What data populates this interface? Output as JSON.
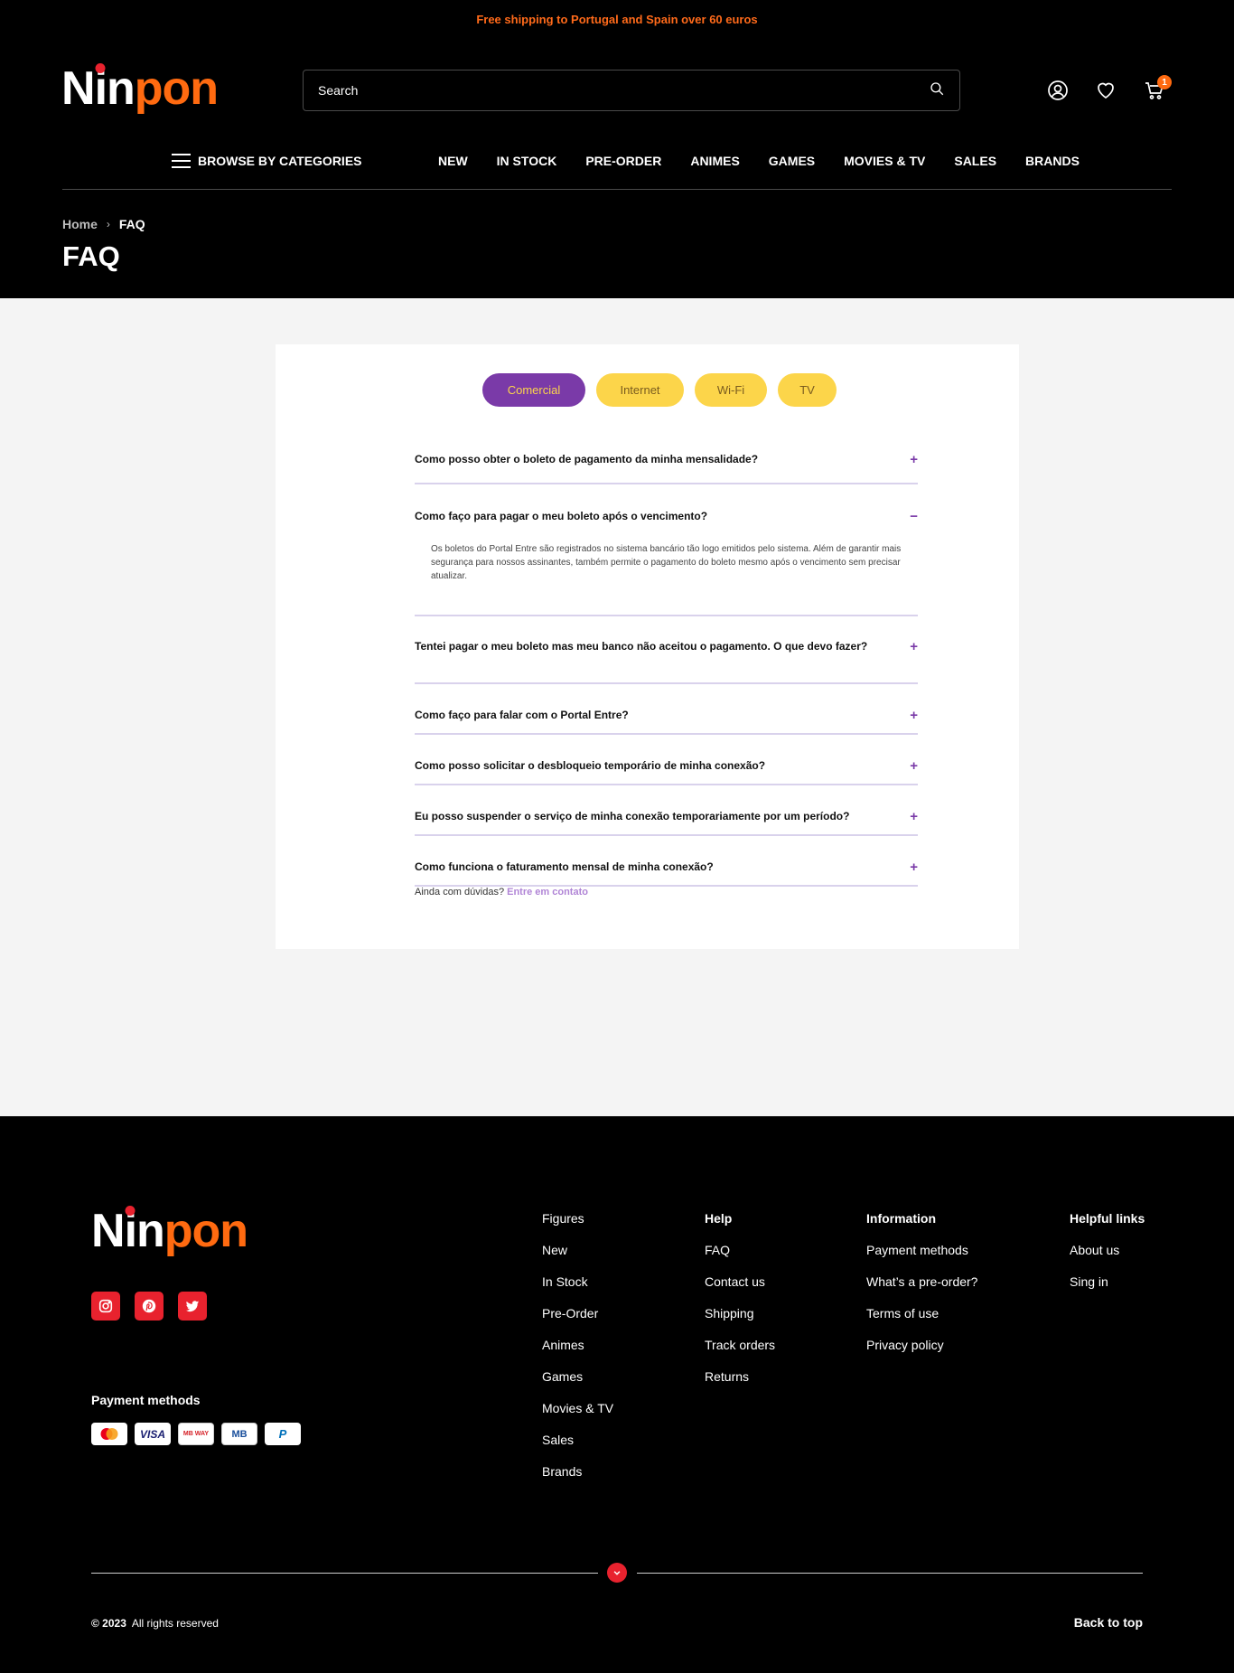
{
  "promo": "Free shipping to Portugal and Spain over 60 euros",
  "logo": {
    "part1": "N",
    "i": "i",
    "part2": "n",
    "part3": "pon"
  },
  "search": {
    "placeholder": "Search"
  },
  "cart": {
    "count": "1"
  },
  "nav": {
    "browse": "BROWSE BY CATEGORIES",
    "links": [
      "NEW",
      "IN STOCK",
      "PRE-ORDER",
      "ANIMES",
      "GAMES",
      "MOVIES & TV",
      "SALES",
      "BRANDS"
    ]
  },
  "breadcrumb": {
    "home": "Home",
    "current": "FAQ"
  },
  "page_title": "FAQ",
  "faq_embed": {
    "tabs": [
      "Comercial",
      "Internet",
      "Wi-Fi",
      "TV"
    ],
    "questions": [
      {
        "q": "Como posso obter o boleto de pagamento da minha mensalidade?",
        "toggle": "+"
      },
      {
        "q": "Como faço para pagar o meu boleto após o vencimento?",
        "toggle": "−",
        "a": "Os boletos do Portal Entre são registrados no sistema bancário tão logo emitidos pelo sistema. Além de garantir mais segurança para nossos assinantes, também permite o pagamento do boleto mesmo após o vencimento sem precisar atualizar."
      },
      {
        "q": "Tentei pagar o meu boleto mas meu banco não aceitou o pagamento. O que devo fazer?",
        "toggle": "+"
      },
      {
        "q": "Como faço para falar com o Portal Entre?",
        "toggle": "+"
      },
      {
        "q": "Como posso solicitar o desbloqueio temporário de minha conexão?",
        "toggle": "+"
      },
      {
        "q": "Eu posso suspender o serviço de minha conexão temporariamente por um período?",
        "toggle": "+"
      },
      {
        "q": "Como funciona o faturamento mensal de minha conexão?",
        "toggle": "+"
      }
    ],
    "footer_text": "Ainda com dúvidas?",
    "footer_link": "Entre em contato"
  },
  "footer": {
    "payment_title": "Payment methods",
    "payment_cards": [
      "mastercard",
      "VISA",
      "MB WAY",
      "MB",
      "P"
    ],
    "columns": [
      {
        "heading": "",
        "items": [
          "Figures",
          "New",
          "In Stock",
          "Pre-Order",
          "Animes",
          "Games",
          "Movies & TV",
          "Sales",
          "Brands"
        ]
      },
      {
        "heading": "Help",
        "items": [
          "FAQ",
          "Contact us",
          "Shipping",
          "Track orders",
          "Returns"
        ]
      },
      {
        "heading": "Information",
        "items": [
          "Payment methods",
          "What’s a pre-order?",
          "Terms of use",
          "Privacy policy"
        ]
      },
      {
        "heading": "Helpful links",
        "items": [
          "About us",
          "Sing in"
        ]
      }
    ],
    "copyright_year": "© 2023",
    "copyright_text": "All rights reserved",
    "back_to_top": "Back to top"
  },
  "colors": {
    "accent": "#ff6a10",
    "logo_dot": "#e8222e",
    "purple": "#7a3aa8",
    "yellow": "#fcd54a"
  }
}
